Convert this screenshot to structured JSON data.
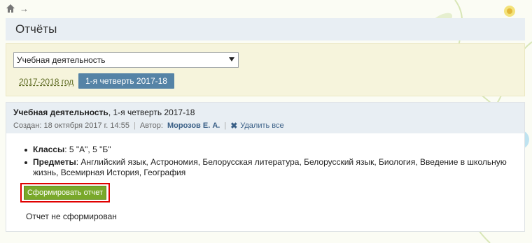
{
  "nav": {
    "home_icon": "home-icon",
    "arrow": "→"
  },
  "page": {
    "title": "Отчёты"
  },
  "filters": {
    "select_value": "Учебная деятельность",
    "year_link": "2017-2018 год",
    "quarter_button": "1-я четверть 2017-18"
  },
  "report": {
    "title_bold": "Учебная деятельность",
    "title_rest": ", 1-я четверть 2017-18",
    "created": "Создан: 18 октября 2017 г. 14:55",
    "author_label": "Автор:",
    "author_name": "Морозов Е. А.",
    "delete_label": "Удалить все",
    "classes_label": "Классы",
    "classes_value": ": 5 \"А\", 5 \"Б\"",
    "subjects_label": "Предметы",
    "subjects_value": ": Английский язык, Астрономия, Белорусская литература, Белорусский язык, Биология, Введение в школьную жизнь, Всемирная История, География",
    "generate_button": "Сформировать отчет",
    "status": "Отчет не сформирован"
  },
  "colors": {
    "accent_blue": "#5583a6",
    "button_green": "#79a82a",
    "highlight_red": "#e00000"
  }
}
